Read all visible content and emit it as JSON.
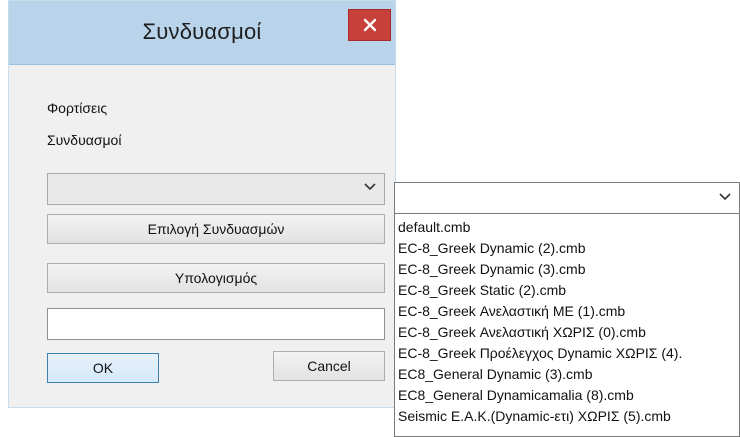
{
  "window": {
    "title": "Συνδυασμοί"
  },
  "form": {
    "label_loads": "Φορτίσεις",
    "label_combinations": "Συνδυασμοί",
    "combo_value": "",
    "select_combinations_button": "Επιλογή Συνδυασμών",
    "calculate_button": "Υπολογισμός",
    "textbox_value": "",
    "ok_button": "OK",
    "cancel_button": "Cancel"
  },
  "dropdown": {
    "selected_value": "",
    "items": [
      "default.cmb",
      "EC-8_Greek Dynamic (2).cmb",
      "EC-8_Greek Dynamic (3).cmb",
      "EC-8_Greek Static (2).cmb",
      "EC-8_Greek Ανελαστική ME (1).cmb",
      "EC-8_Greek Ανελαστική ΧΩΡΙΣ (0).cmb",
      "EC-8_Greek Προέλεγχος Dynamic ΧΩΡΙΣ (4).",
      "EC8_General Dynamic (3).cmb",
      "EC8_General Dynamicamalia (8).cmb",
      "Seismic Ε.Α.Κ.(Dynamic-ετι) ΧΩΡΙΣ (5).cmb"
    ]
  },
  "icons": {
    "close": "close-icon",
    "chevron": "chevron-down-icon"
  },
  "colors": {
    "titlebar": "#b8d3ea",
    "close_button": "#c7403a",
    "dialog_bg": "#f0f0f0"
  }
}
